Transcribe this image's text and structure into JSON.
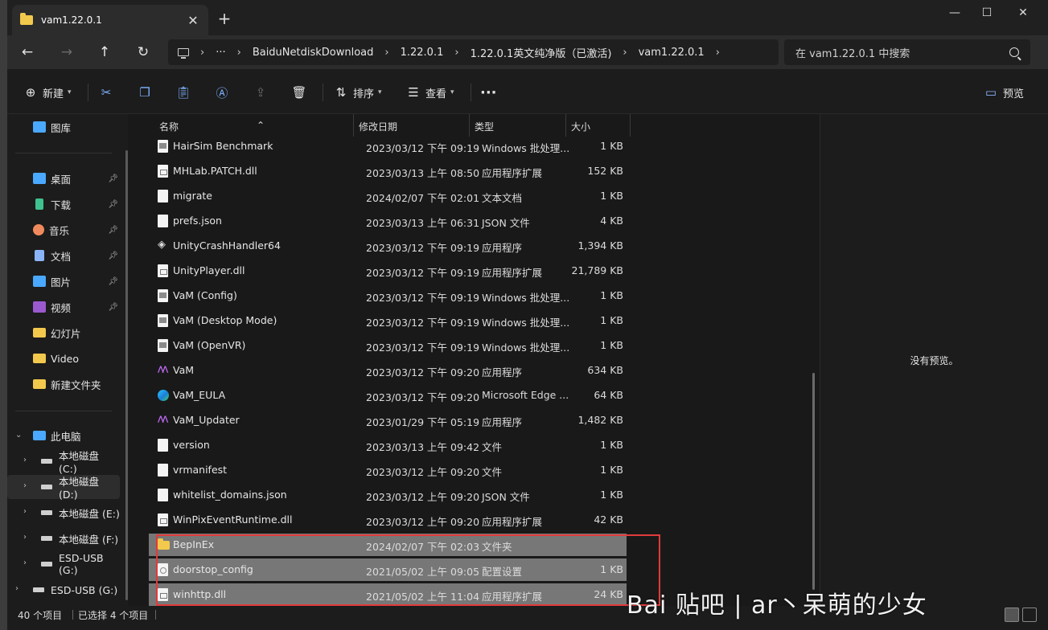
{
  "tab": {
    "title": "vam1.22.0.1",
    "close": "✕",
    "add": "+"
  },
  "window_controls": {
    "minimize": "—",
    "maximize": "☐",
    "close": "✕"
  },
  "nav": {
    "back": "←",
    "forward": "→",
    "up": "↑",
    "refresh": "↻",
    "more": "···",
    "breadcrumbs": [
      "BaiduNetdiskDownload",
      "1.22.0.1",
      "1.22.0.1英文纯净版（已激活)",
      "vam1.22.0.1"
    ],
    "sep": "›",
    "search_placeholder": "在 vam1.22.0.1 中搜索"
  },
  "toolbar": {
    "new_label": "新建",
    "sort_label": "排序",
    "view_label": "查看",
    "more": "···",
    "preview_label": "预览"
  },
  "sidebar": {
    "items": [
      {
        "label": "图库",
        "icon": "gallery-icon",
        "color": "#4aa8ff"
      },
      {
        "label": "桌面",
        "icon": "desktop-icon",
        "color": "#4aa8ff",
        "pinned": true
      },
      {
        "label": "下载",
        "icon": "download-icon",
        "color": "#3fc18f",
        "pinned": true
      },
      {
        "label": "音乐",
        "icon": "music-icon",
        "color": "#f08a5d",
        "pinned": true
      },
      {
        "label": "文档",
        "icon": "document-icon",
        "color": "#8ab4f8",
        "pinned": true
      },
      {
        "label": "图片",
        "icon": "pictures-icon",
        "color": "#4aa8ff",
        "pinned": true
      },
      {
        "label": "视频",
        "icon": "videos-icon",
        "color": "#9b59d0",
        "pinned": true
      },
      {
        "label": "幻灯片",
        "icon": "folder-icon",
        "color": "#f2c94c"
      },
      {
        "label": "Video",
        "icon": "folder-icon",
        "color": "#f2c94c"
      },
      {
        "label": "新建文件夹",
        "icon": "folder-icon",
        "color": "#f2c94c"
      }
    ],
    "this_pc": "此电脑",
    "drives": [
      {
        "label": "本地磁盘 (C:)"
      },
      {
        "label": "本地磁盘 (D:)"
      },
      {
        "label": "本地磁盘 (E:)"
      },
      {
        "label": "本地磁盘 (F:)"
      },
      {
        "label": "ESD-USB (G:)"
      },
      {
        "label": "ESD-USB (G:)"
      }
    ]
  },
  "columns": {
    "name": "名称",
    "date": "修改日期",
    "type": "类型",
    "size": "大小"
  },
  "files": [
    {
      "name": "HairSim Benchmark",
      "date": "2023/03/12 下午 09:19",
      "type": "Windows 批处理...",
      "size": "1 KB",
      "icon": "bat"
    },
    {
      "name": "MHLab.PATCH.dll",
      "date": "2023/03/13 上午 08:50",
      "type": "应用程序扩展",
      "size": "152 KB",
      "icon": "dll"
    },
    {
      "name": "migrate",
      "date": "2024/02/07 下午 02:01",
      "type": "文本文档",
      "size": "1 KB",
      "icon": "doc"
    },
    {
      "name": "prefs.json",
      "date": "2023/03/13 上午 06:31",
      "type": "JSON 文件",
      "size": "4 KB",
      "icon": "doc"
    },
    {
      "name": "UnityCrashHandler64",
      "date": "2023/03/12 下午 09:19",
      "type": "应用程序",
      "size": "1,394 KB",
      "icon": "unity"
    },
    {
      "name": "UnityPlayer.dll",
      "date": "2023/03/12 下午 09:19",
      "type": "应用程序扩展",
      "size": "21,789 KB",
      "icon": "dll"
    },
    {
      "name": "VaM (Config)",
      "date": "2023/03/12 下午 09:19",
      "type": "Windows 批处理...",
      "size": "1 KB",
      "icon": "bat"
    },
    {
      "name": "VaM (Desktop Mode)",
      "date": "2023/03/12 下午 09:19",
      "type": "Windows 批处理...",
      "size": "1 KB",
      "icon": "bat"
    },
    {
      "name": "VaM (OpenVR)",
      "date": "2023/03/12 下午 09:19",
      "type": "Windows 批处理...",
      "size": "1 KB",
      "icon": "bat"
    },
    {
      "name": "VaM",
      "date": "2023/03/12 下午 09:20",
      "type": "应用程序",
      "size": "634 KB",
      "icon": "vam"
    },
    {
      "name": "VaM_EULA",
      "date": "2023/03/12 下午 09:20",
      "type": "Microsoft Edge ...",
      "size": "64 KB",
      "icon": "edge"
    },
    {
      "name": "VaM_Updater",
      "date": "2023/01/29 下午 05:19",
      "type": "应用程序",
      "size": "1,482 KB",
      "icon": "vam"
    },
    {
      "name": "version",
      "date": "2023/03/13 上午 09:42",
      "type": "文件",
      "size": "1 KB",
      "icon": "doc"
    },
    {
      "name": "vrmanifest",
      "date": "2023/03/12 上午 09:20",
      "type": "文件",
      "size": "1 KB",
      "icon": "doc"
    },
    {
      "name": "whitelist_domains.json",
      "date": "2023/03/12 上午 09:20",
      "type": "JSON 文件",
      "size": "1 KB",
      "icon": "doc"
    },
    {
      "name": "WinPixEventRuntime.dll",
      "date": "2023/03/12 上午 09:20",
      "type": "应用程序扩展",
      "size": "42 KB",
      "icon": "dll"
    },
    {
      "name": "BepInEx",
      "date": "2024/02/07 下午 02:03",
      "type": "文件夹",
      "size": "",
      "icon": "folder",
      "selected": true
    },
    {
      "name": "doorstop_config",
      "date": "2021/05/02 上午 09:05",
      "type": "配置设置",
      "size": "1 KB",
      "icon": "cfg",
      "selected": true
    },
    {
      "name": "winhttp.dll",
      "date": "2021/05/02 上午 11:04",
      "type": "应用程序扩展",
      "size": "24 KB",
      "icon": "dll",
      "selected": true
    }
  ],
  "preview": {
    "empty_text": "没有预览。"
  },
  "status": {
    "count": "40 个项目",
    "selected": "已选择 4 个项目",
    "sep": "|"
  },
  "watermark": "Bai 贴吧 | ar丶呆萌的少女",
  "colors": {
    "selection": "#777777",
    "highlight_box": "#e03b3b",
    "accent": "#7fb2ff"
  }
}
